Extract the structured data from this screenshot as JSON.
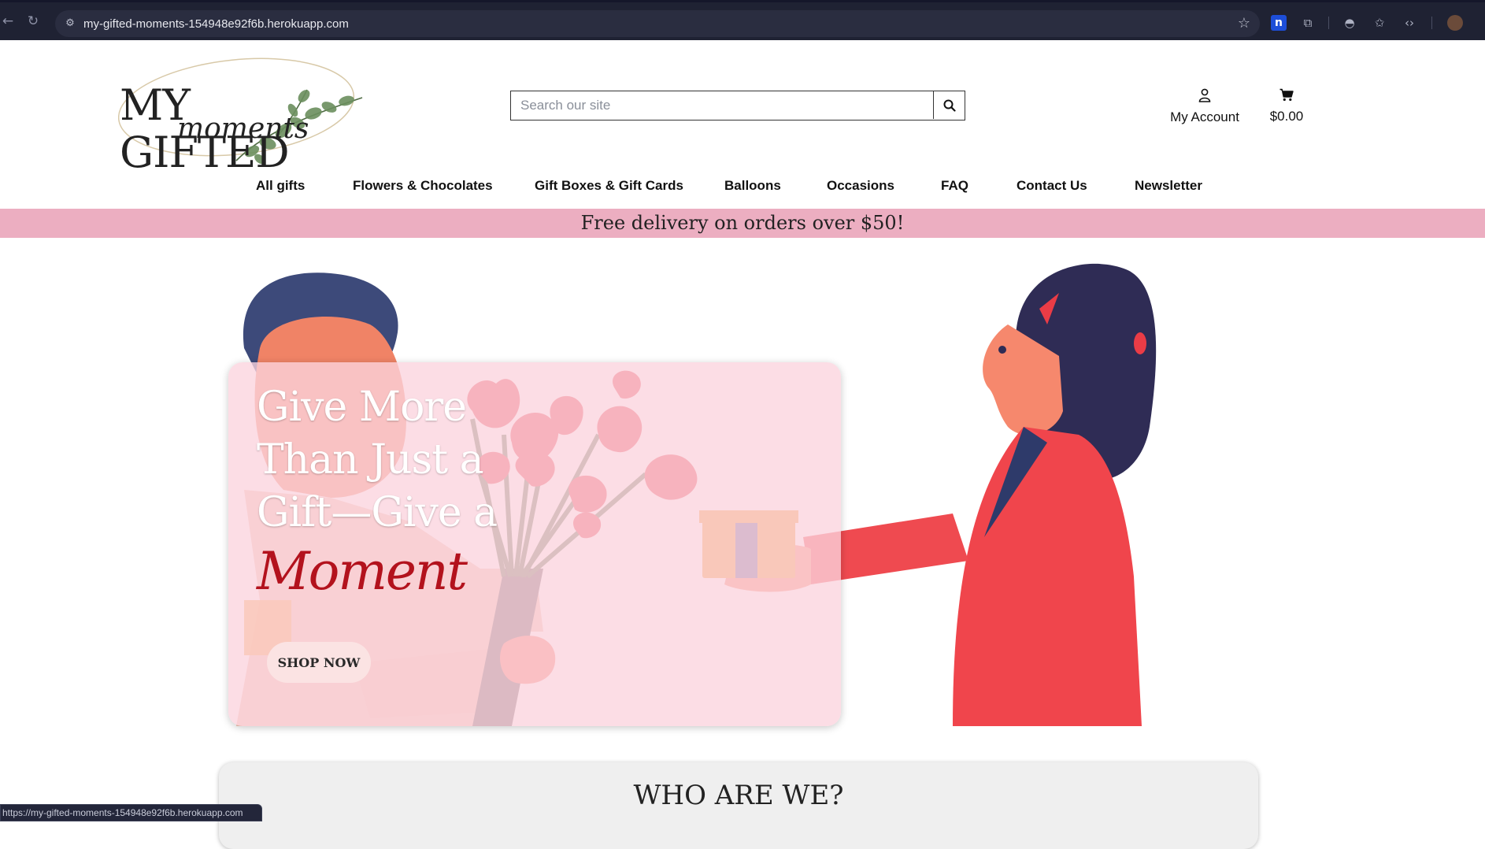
{
  "browser": {
    "url": "my-gifted-moments-154948e92f6b.herokuapp.com",
    "status_url": "https://my-gifted-moments-154948e92f6b.herokuapp.com",
    "extension_letter": "n"
  },
  "header": {
    "logo_main": "MY GIFTED",
    "logo_script": "moments",
    "search_placeholder": "Search our site",
    "account_label": "My Account",
    "cart_total": "$0.00"
  },
  "nav": {
    "items": [
      {
        "label": "All gifts"
      },
      {
        "label": "Flowers & Chocolates"
      },
      {
        "label": "Gift Boxes & Gift Cards"
      },
      {
        "label": "Balloons"
      },
      {
        "label": "Occasions"
      },
      {
        "label": "FAQ"
      },
      {
        "label": "Contact Us"
      },
      {
        "label": "Newsletter"
      }
    ]
  },
  "promo": {
    "text": "Free delivery on orders over $50!",
    "color": "#ecaec1"
  },
  "hero": {
    "line1": "Give More",
    "line2": "Than Just a",
    "line3": "Gift—Give a",
    "script_word": "Moment",
    "cta_label": "SHOP NOW",
    "script_color": "#b3121d"
  },
  "about": {
    "title": "WHO ARE WE?"
  },
  "icons": {
    "back": "back-arrow-icon",
    "reload": "reload-icon",
    "search": "search-icon",
    "account": "user-icon",
    "cart": "cart-icon"
  }
}
